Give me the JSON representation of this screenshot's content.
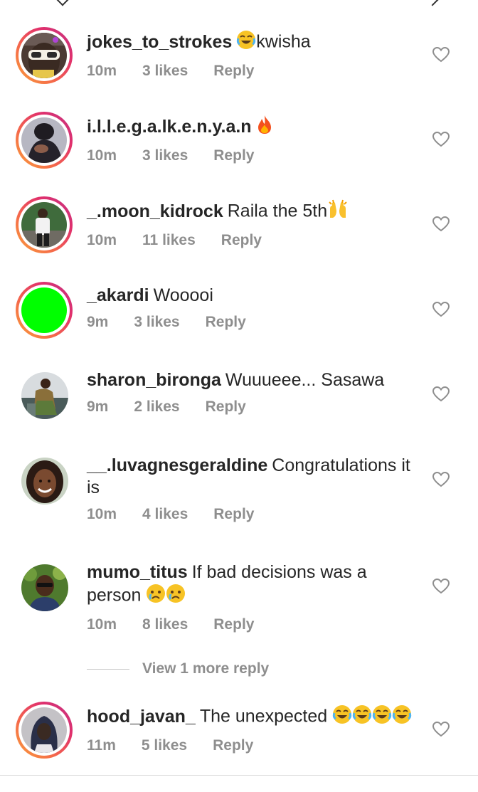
{
  "comments": [
    {
      "user": "jokes_to_strokes",
      "text": "kwisha",
      "time": "10m",
      "likes": "3 likes",
      "reply": "Reply",
      "avatar": "avatar-photo-sunglasses"
    },
    {
      "user": "i.l.l.e.g.a.lk.e.n.y.a.n",
      "text": "",
      "time": "10m",
      "likes": "3 likes",
      "reply": "Reply",
      "avatar": "avatar-photo-dark"
    },
    {
      "user": "_.moon_kidrock",
      "text": "Raila the 5th",
      "time": "10m",
      "likes": "11 likes",
      "reply": "Reply",
      "avatar": "avatar-photo-person"
    },
    {
      "user": "_akardi",
      "text": "Wooooi",
      "time": "9m",
      "likes": "3 likes",
      "reply": "Reply",
      "avatar": "avatar-green"
    },
    {
      "user": "sharon_bironga",
      "text": "Wuuueee... Sasawa",
      "time": "9m",
      "likes": "2 likes",
      "reply": "Reply",
      "avatar": "avatar-photo-sharon"
    },
    {
      "user": "__.luvagnesgeraldine",
      "text": "Congratulations it is",
      "time": "10m",
      "likes": "4 likes",
      "reply": "Reply",
      "avatar": "avatar-photo-woman"
    },
    {
      "user": "mumo_titus",
      "text": "If bad decisions was a person",
      "time": "10m",
      "likes": "8 likes",
      "reply": "Reply",
      "avatar": "avatar-photo-man"
    },
    {
      "user": "hood_javan_",
      "text": "The unexpected",
      "time": "11m",
      "likes": "5 likes",
      "reply": "Reply",
      "avatar": "avatar-photo-hood"
    }
  ],
  "view_more": "View 1 more reply",
  "icons": {
    "heart": "heart-outline-icon",
    "laugh_emoji": "face-with-tears-of-joy-emoji",
    "fire_emoji": "fire-emoji",
    "hands_emoji": "raising-hands-emoji",
    "cry_emoji": "crying-face-emoji"
  },
  "colors": {
    "text": "#262626",
    "meta": "#8e8e8e",
    "story_ring": "#e1306c",
    "green_avatar": "#00ff00"
  }
}
